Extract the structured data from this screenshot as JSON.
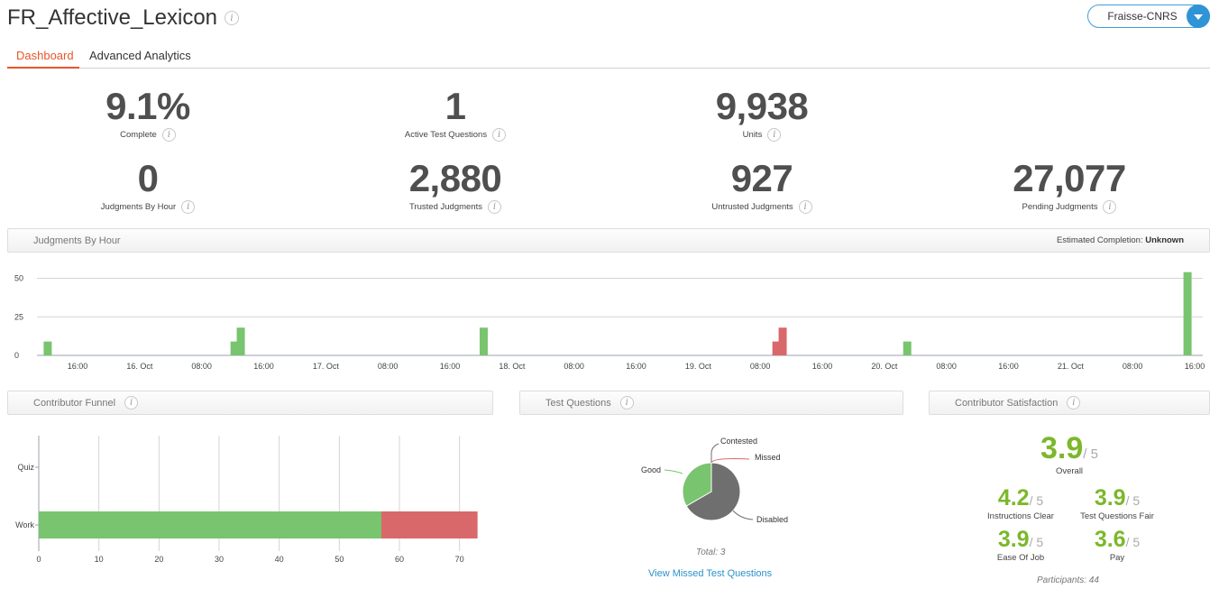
{
  "header": {
    "title": "FR_Affective_Lexicon",
    "info_glyph": "i",
    "team": "Fraisse-CNRS"
  },
  "tabs": [
    {
      "label": "Dashboard"
    },
    {
      "label": "Advanced Analytics"
    }
  ],
  "stats": {
    "complete": {
      "value": "9.1%",
      "label": "Complete"
    },
    "active_tq": {
      "value": "1",
      "label": "Active Test Questions"
    },
    "units": {
      "value": "9,938",
      "label": "Units"
    },
    "jph": {
      "value": "0",
      "label": "Judgments By Hour"
    },
    "trusted": {
      "value": "2,880",
      "label": "Trusted Judgments"
    },
    "untrusted": {
      "value": "927",
      "label": "Untrusted Judgments"
    },
    "pending": {
      "value": "27,077",
      "label": "Pending Judgments"
    }
  },
  "judgments_panel": {
    "title": "Judgments By Hour",
    "estimated_label": "Estimated Completion:",
    "estimated_value": "Unknown"
  },
  "funnel_panel": {
    "title": "Contributor Funnel"
  },
  "tq_panel": {
    "title": "Test Questions",
    "total": "Total: 3",
    "link": "View Missed Test Questions"
  },
  "sat_panel": {
    "title": "Contributor Satisfaction",
    "overall": {
      "score": "3.9",
      "out_of": "/ 5",
      "label": "Overall"
    },
    "instructions": {
      "score": "4.2",
      "out_of": "/ 5",
      "label": "Instructions Clear"
    },
    "tq_fair": {
      "score": "3.9",
      "out_of": "/ 5",
      "label": "Test Questions Fair"
    },
    "ease": {
      "score": "3.9",
      "out_of": "/ 5",
      "label": "Ease Of Job"
    },
    "pay": {
      "score": "3.6",
      "out_of": "/ 5",
      "label": "Pay"
    },
    "participants": "Participants: 44"
  },
  "colors": {
    "green": "#79c46e",
    "red": "#d9686a",
    "grey": "#6f6f6f",
    "accent": "#e8552a",
    "link": "#2a92c9",
    "score": "#7bb82a"
  },
  "chart_data": [
    {
      "type": "bar",
      "title": "Judgments By Hour",
      "xlabel": "",
      "ylabel": "",
      "ylim": [
        0,
        55
      ],
      "yticks": [
        0,
        25,
        50
      ],
      "xtick_labels": [
        "16:00",
        "16. Oct",
        "08:00",
        "16:00",
        "17. Oct",
        "08:00",
        "16:00",
        "18. Oct",
        "08:00",
        "16:00",
        "19. Oct",
        "08:00",
        "16:00",
        "20. Oct",
        "08:00",
        "16:00",
        "21. Oct",
        "08:00",
        "16:00"
      ],
      "x_range_hours": [
        0,
        185
      ],
      "series": [
        {
          "color": "green",
          "points": [
            {
              "x": 1,
              "y": 9
            },
            {
              "x": 31,
              "y": 9
            },
            {
              "x": 32,
              "y": 18
            },
            {
              "x": 71,
              "y": 18
            },
            {
              "x": 139,
              "y": 9
            },
            {
              "x": 184,
              "y": 54
            }
          ]
        },
        {
          "color": "red",
          "points": [
            {
              "x": 118,
              "y": 9
            },
            {
              "x": 119,
              "y": 18
            }
          ]
        }
      ],
      "grid": true
    },
    {
      "type": "bar",
      "orientation": "horizontal",
      "categories": [
        "Quiz",
        "Work"
      ],
      "series": [
        {
          "color": "green",
          "values": [
            0,
            57
          ]
        },
        {
          "color": "red",
          "values": [
            0,
            16
          ]
        }
      ],
      "xlim": [
        0,
        75
      ],
      "xticks": [
        0,
        10,
        20,
        30,
        40,
        50,
        60,
        70
      ],
      "stacked": true,
      "grid": true
    },
    {
      "type": "pie",
      "slices": [
        {
          "label": "Good",
          "value": 1,
          "color": "green"
        },
        {
          "label": "Contested",
          "value": 0,
          "color": "grey"
        },
        {
          "label": "Missed",
          "value": 0,
          "color": "red"
        },
        {
          "label": "Disabled",
          "value": 2,
          "color": "grey"
        }
      ]
    }
  ]
}
